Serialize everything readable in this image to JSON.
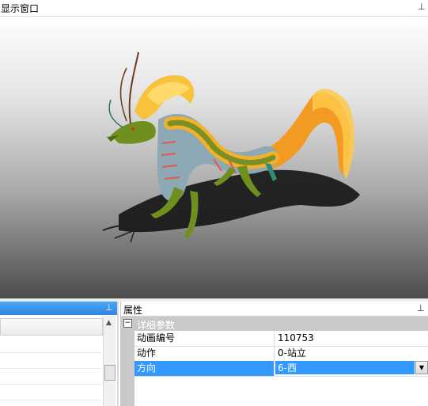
{
  "display": {
    "title": "显示窗口",
    "pin_glyph": "📌",
    "background_gradient": [
      "#ffffff",
      "#4c4c4c"
    ]
  },
  "left_panel": {
    "accent": "#3a94ec",
    "pin_glyph": "📌"
  },
  "properties": {
    "title": "属性",
    "pin_glyph": "📌",
    "category": {
      "expander_glyph": "⊟",
      "label": "详细参数"
    },
    "rows": [
      {
        "name": "动画编号",
        "value": "110753"
      },
      {
        "name": "动作",
        "value": "0-站立"
      },
      {
        "name": "方向",
        "value": "6-西",
        "selected": true
      }
    ],
    "dropdown_glyph": "▼",
    "selection_color": "#3399ff"
  },
  "sprite": {
    "icon": "dragon-sprite",
    "colors": [
      "#f7b32c",
      "#8aa6b4",
      "#6f8f1f",
      "#ec5a3a"
    ]
  }
}
